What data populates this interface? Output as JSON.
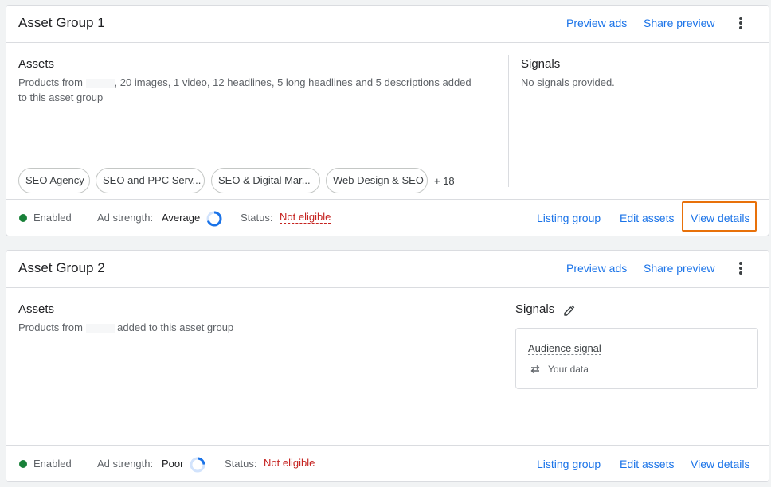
{
  "asset_groups": [
    {
      "title": "Asset Group 1",
      "header_links": [
        "Preview ads",
        "Share preview"
      ],
      "assets_title": "Assets",
      "assets_text_pre": "Products from",
      "assets_text_post": ", 20 images, 1 video, 12 headlines, 5 long headlines and 5 descriptions added",
      "assets_text_line2": "to this asset group",
      "chips": [
        "SEO Agency",
        "SEO and PPC Serv...",
        "SEO & Digital Mar...",
        "Web Design & SEO"
      ],
      "more_chips": "+ 18",
      "signals_title": "Signals",
      "signals_text": "No signals provided.",
      "status_enabled": "Enabled",
      "ad_strength_label": "Ad strength:",
      "ad_strength_value": "Average",
      "status_label": "Status:",
      "status_value": "Not eligible",
      "footer_links": [
        "Listing group",
        "Edit assets",
        "View details"
      ]
    },
    {
      "title": "Asset Group 2",
      "header_links": [
        "Preview ads",
        "Share preview"
      ],
      "assets_title": "Assets",
      "assets_text_pre": "Products from",
      "assets_text_post": "added to this asset group",
      "signals_title": "Signals",
      "audience_signal": "Audience signal",
      "audience_sub": "Your data",
      "status_enabled": "Enabled",
      "ad_strength_label": "Ad strength:",
      "ad_strength_value": "Poor",
      "status_label": "Status:",
      "status_value": "Not eligible",
      "footer_links": [
        "Listing group",
        "Edit assets",
        "View details"
      ]
    }
  ],
  "colors": {
    "link": "#1a73e8",
    "enabled": "#188038",
    "not_eligible": "#c5221f",
    "highlight": "#e8710a"
  }
}
